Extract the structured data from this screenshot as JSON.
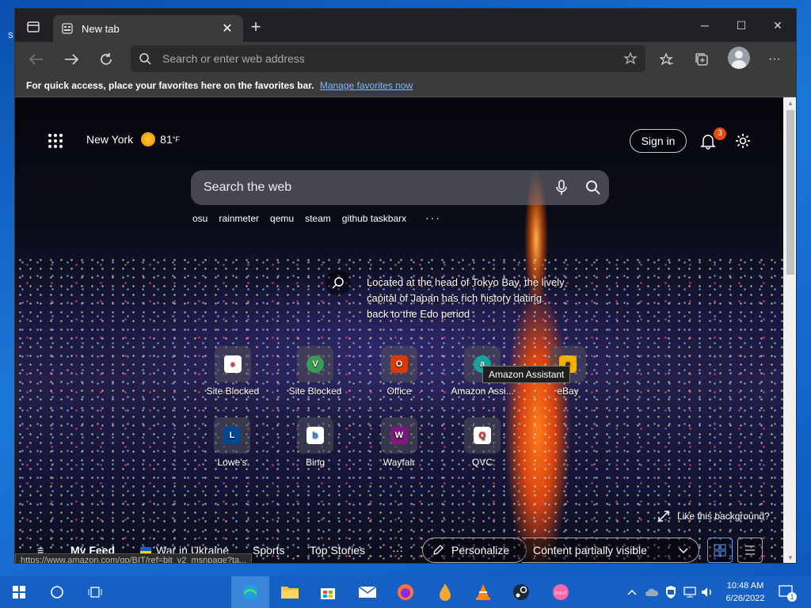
{
  "window": {
    "tab_title": "New tab"
  },
  "address": {
    "placeholder": "Search or enter web address"
  },
  "favbar": {
    "message": "For quick access, place your favorites here on the favorites bar.",
    "link": "Manage favorites now"
  },
  "ntp": {
    "location": "New York",
    "temp": "81",
    "unit": "°F",
    "sign_in": "Sign in",
    "notif_count": "3",
    "search_placeholder": "Search the web",
    "trending": [
      "osu",
      "rainmeter",
      "qemu",
      "steam",
      "github taskbarx"
    ],
    "trending_more": "···",
    "info": "Located at the head of Tokyo Bay, the lively capital of Japan has rich history dating back to the Edo period",
    "tiles": [
      {
        "label": "Site Blocked",
        "color": "#e8334a",
        "glyph": "●"
      },
      {
        "label": "Site Blocked",
        "color": "#3a9b55",
        "glyph": "V"
      },
      {
        "label": "Office",
        "color": "#d83b01",
        "glyph": "O"
      },
      {
        "label": "Amazon Assi...",
        "color": "#1aa39a",
        "glyph": "a"
      },
      {
        "label": "eBay",
        "color": "#f5af02",
        "glyph": "e"
      },
      {
        "label": "Lowe's",
        "color": "#004990",
        "glyph": "L"
      },
      {
        "label": "Bing",
        "color": "#1f74d6",
        "glyph": "b"
      },
      {
        "label": "Wayfair",
        "color": "#7f187f",
        "glyph": "W"
      },
      {
        "label": "QVC",
        "color": "#d72020",
        "glyph": "Q"
      }
    ],
    "tooltip": "Amazon Assistant",
    "like_bg": "Like this background?",
    "feed": {
      "menu": "≡",
      "my_feed": "My Feed",
      "ukraine": "War in Ukraine",
      "sports": "Sports",
      "top_stories": "Top Stories",
      "more": "···"
    },
    "personalize": "Personalize",
    "content_vis": "Content partially visible"
  },
  "status_url": "https://www.amazon.com/gp/BIT/ref=bit_v2_msnpage?ta...",
  "taskbar": {
    "time": "10:48 AM",
    "date": "6/26/2022",
    "notif": "1"
  }
}
